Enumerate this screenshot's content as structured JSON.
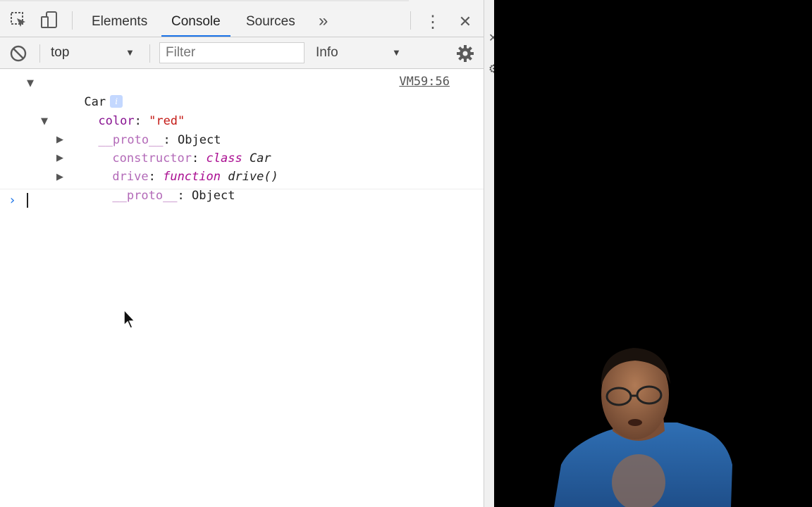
{
  "devtools": {
    "tabs": [
      {
        "label": "Elements",
        "active": false
      },
      {
        "label": "Console",
        "active": true
      },
      {
        "label": "Sources",
        "active": false
      }
    ],
    "more_tabs_glyph": "»",
    "menu_glyph": "⋮",
    "close_glyph": "✕",
    "icons": [
      "inspect-element-icon",
      "device-toolbar-icon",
      "clear-console-icon",
      "settings-gear-icon"
    ]
  },
  "toolbar": {
    "context_value": "top",
    "filter_placeholder": "Filter",
    "level_value": "Info"
  },
  "console": {
    "source_link": "VM59:56",
    "object_name": "Car",
    "info_badge": "i",
    "rows": {
      "color_key": "color",
      "color_value": "\"red\"",
      "proto_key": "__proto__",
      "proto_value": "Object",
      "constructor_key": "constructor",
      "constructor_kw": "class",
      "constructor_value": "Car",
      "drive_key": "drive",
      "drive_kw": "function",
      "drive_value": "drive()",
      "inner_proto_key": "__proto__",
      "inner_proto_value": "Object"
    },
    "prompt_glyph": "›"
  },
  "colors": {
    "accent": "#1a73e8",
    "property_key": "#881391",
    "string_value": "#c41a16",
    "keyword": "#aa0d91",
    "toolbar_bg": "#f3f3f3"
  }
}
